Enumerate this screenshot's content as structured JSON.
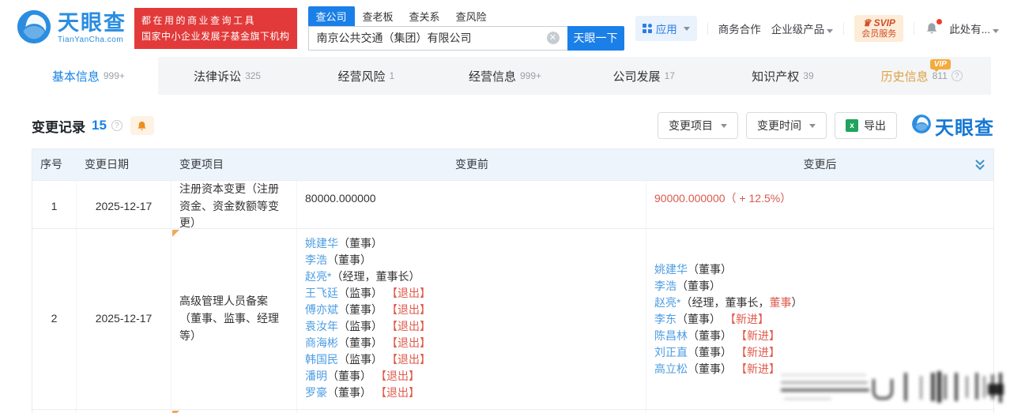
{
  "header": {
    "brand": {
      "name": "天眼查",
      "domain": "TianYanCha.com"
    },
    "promo": {
      "line1": "都在用的商业查询工具",
      "line2": "国家中小企业发展子基金旗下机构"
    },
    "search": {
      "tabs": [
        {
          "label": "查公司",
          "active": true
        },
        {
          "label": "查老板",
          "active": false
        },
        {
          "label": "查关系",
          "active": false
        },
        {
          "label": "查风险",
          "active": false
        }
      ],
      "value": "南京公共交通（集团）有限公司",
      "submit_label": "天眼一下"
    },
    "nav": {
      "apps_label": "应用",
      "biz_label": "商务合作",
      "enterprise_label": "企业级产品",
      "svip_top": "SVIP",
      "svip_bottom": "会员服务",
      "more_label": "此处有..."
    }
  },
  "nav_tabs": [
    {
      "label": "基本信息",
      "count": "999+",
      "active": true
    },
    {
      "label": "法律诉讼",
      "count": "325"
    },
    {
      "label": "经营风险",
      "count": "1"
    },
    {
      "label": "经营信息",
      "count": "999+"
    },
    {
      "label": "公司发展",
      "count": "17"
    },
    {
      "label": "知识产权",
      "count": "39"
    },
    {
      "label": "历史信息",
      "count": "811",
      "vip_badge": "VIP",
      "highlighted": true,
      "has_help": true
    }
  ],
  "section": {
    "title": "变更记录",
    "count": "15",
    "filter_item_label": "变更项目",
    "filter_time_label": "变更时间",
    "export_label": "导出",
    "watermark_brand": "天眼查"
  },
  "table": {
    "headers": {
      "no": "序号",
      "date": "变更日期",
      "item": "变更项目",
      "before": "变更前",
      "after": "变更后"
    },
    "rows": [
      {
        "no": "1",
        "date": "2025-12-17",
        "item": "注册资本变更（注册资金、资金数额等变更）",
        "before_text": "80000.000000",
        "after_text": "90000.000000（ + 12.5%）"
      },
      {
        "no": "2",
        "date": "2025-12-17",
        "item": "高级管理人员备案（董事、监事、经理等）",
        "before_people": [
          {
            "name": "姚建华",
            "role": "（董事）"
          },
          {
            "name": "李浩",
            "role": "（董事）"
          },
          {
            "name": "赵亮*",
            "role": "（经理，董事长）"
          },
          {
            "name": "王飞廷",
            "role": "（监事）",
            "tag": "【退出】"
          },
          {
            "name": "傅亦斌",
            "role": "（董事）",
            "tag": "【退出】"
          },
          {
            "name": "袁汝年",
            "role": "（监事）",
            "tag": "【退出】"
          },
          {
            "name": "商海彬",
            "role": "（董事）",
            "tag": "【退出】"
          },
          {
            "name": "韩国民",
            "role": "（监事）",
            "tag": "【退出】"
          },
          {
            "name": "潘明",
            "role": "（董事）",
            "tag": "【退出】"
          },
          {
            "name": "罗豪",
            "role": "（董事）",
            "tag": "【退出】"
          }
        ],
        "after_people": [
          {
            "name": "姚建华",
            "role": "（董事）"
          },
          {
            "name": "李浩",
            "role": "（董事）"
          },
          {
            "name": "赵亮*",
            "role_parts": [
              {
                "text": "（经理，董事长，"
              },
              {
                "text": "董事",
                "red": true
              },
              {
                "text": "）"
              }
            ]
          },
          {
            "name": "李东",
            "role": "（董事）",
            "tag": "【新进】"
          },
          {
            "name": "陈昌林",
            "role": "（董事）",
            "tag": "【新进】"
          },
          {
            "name": "刘正直",
            "role": "（董事）",
            "tag": "【新进】"
          },
          {
            "name": "高立松",
            "role": "（董事）",
            "tag": "【新进】"
          }
        ]
      }
    ]
  },
  "colors": {
    "primary_blue": "#1b7fe8",
    "link_blue": "#4d9de3",
    "alert_red": "#dd584c",
    "brand_red": "#e23a3a",
    "gold": "#e2a33d",
    "table_header_bg": "#eef4fb"
  }
}
